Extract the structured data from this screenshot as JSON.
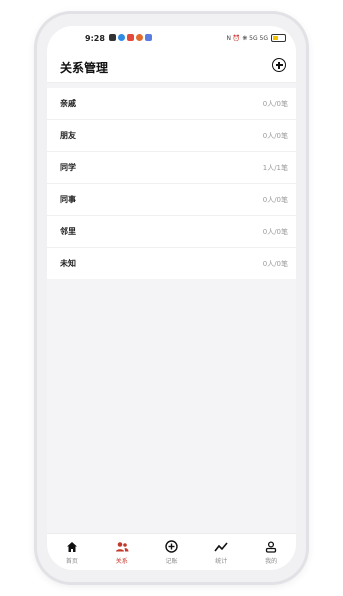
{
  "status_bar": {
    "time": "9:28",
    "right_text": "N ⏰ ❋ 5G 5G",
    "app_icon_colors": [
      "#333333",
      "#2e8be6",
      "#e24b3b",
      "#e26c2e",
      "#5a7ddf"
    ]
  },
  "header": {
    "title": "关系管理",
    "add_icon": "plus-circle-icon"
  },
  "relations": [
    {
      "name": "亲戚",
      "count": "0人/0笔"
    },
    {
      "name": "朋友",
      "count": "0人/0笔"
    },
    {
      "name": "同学",
      "count": "1人/1笔"
    },
    {
      "name": "同事",
      "count": "0人/0笔"
    },
    {
      "name": "邻里",
      "count": "0人/0笔"
    },
    {
      "name": "未知",
      "count": "0人/0笔"
    }
  ],
  "tabbar": {
    "tabs": [
      {
        "label": "首页",
        "icon": "home-icon"
      },
      {
        "label": "关系",
        "icon": "people-icon"
      },
      {
        "label": "记账",
        "icon": "plus-circle-icon"
      },
      {
        "label": "统计",
        "icon": "trend-icon"
      },
      {
        "label": "我的",
        "icon": "user-icon"
      }
    ],
    "active_index": 1
  },
  "colors": {
    "accent": "#c0392b",
    "background": "#f4f4f6"
  }
}
